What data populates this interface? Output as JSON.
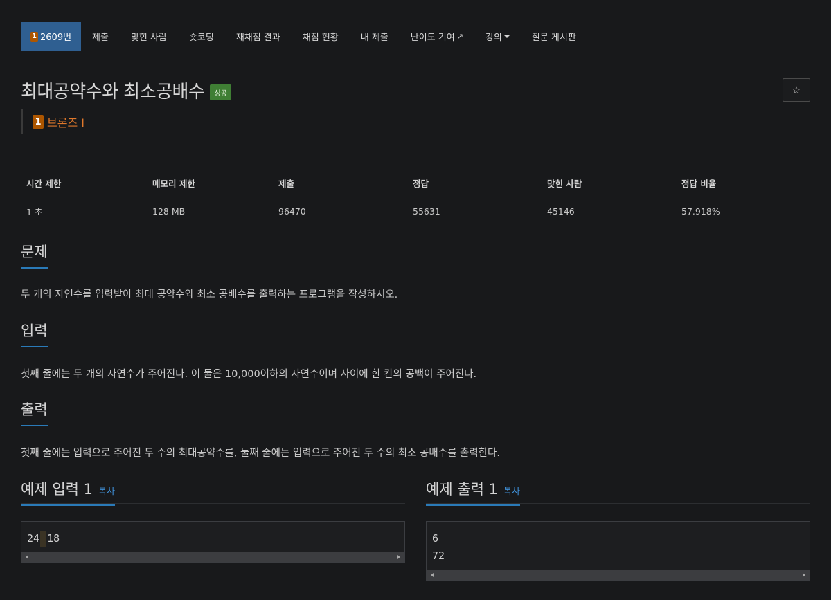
{
  "nav": {
    "problem_number": "2609번",
    "tier_digit": "1",
    "items": [
      "제출",
      "맞힌 사람",
      "숏코딩",
      "재채점 결과",
      "채점 현황",
      "내 제출",
      "난이도 기여",
      "강의",
      "질문 게시판"
    ]
  },
  "problem": {
    "title": "최대공약수와 최소공배수",
    "status_badge": "성공",
    "tier_label": "브론즈 I",
    "tier_digit": "1",
    "tier_color": "#ad5600"
  },
  "info_table": {
    "headers": [
      "시간 제한",
      "메모리 제한",
      "제출",
      "정답",
      "맞힌 사람",
      "정답 비율"
    ],
    "values": [
      "1 초",
      "128 MB",
      "96470",
      "55631",
      "45146",
      "57.918%"
    ]
  },
  "sections": {
    "description": {
      "title": "문제",
      "text": "두 개의 자연수를 입력받아 최대 공약수와 최소 공배수를 출력하는 프로그램을 작성하시오."
    },
    "input": {
      "title": "입력",
      "text": "첫째 줄에는 두 개의 자연수가 주어진다. 이 둘은 10,000이하의 자연수이며 사이에 한 칸의 공백이 주어진다."
    },
    "output": {
      "title": "출력",
      "text": "첫째 줄에는 입력으로 주어진 두 수의 최대공약수를, 둘째 줄에는 입력으로 주어진 두 수의 최소 공배수를 출력한다."
    }
  },
  "samples": {
    "input": {
      "title": "예제 입력 1",
      "copy_label": "복사",
      "left": "24",
      "right": "18"
    },
    "output": {
      "title": "예제 출력 1",
      "copy_label": "복사",
      "lines": [
        "6",
        "72"
      ]
    }
  },
  "icons": {
    "star": "star-icon",
    "external": "external-link-icon",
    "caret": "caret-down-icon"
  },
  "colors": {
    "accent": "#2a7ab8",
    "nav_active": "#2f5f91",
    "success": "#3f7e34",
    "bronze": "#e0782b"
  }
}
